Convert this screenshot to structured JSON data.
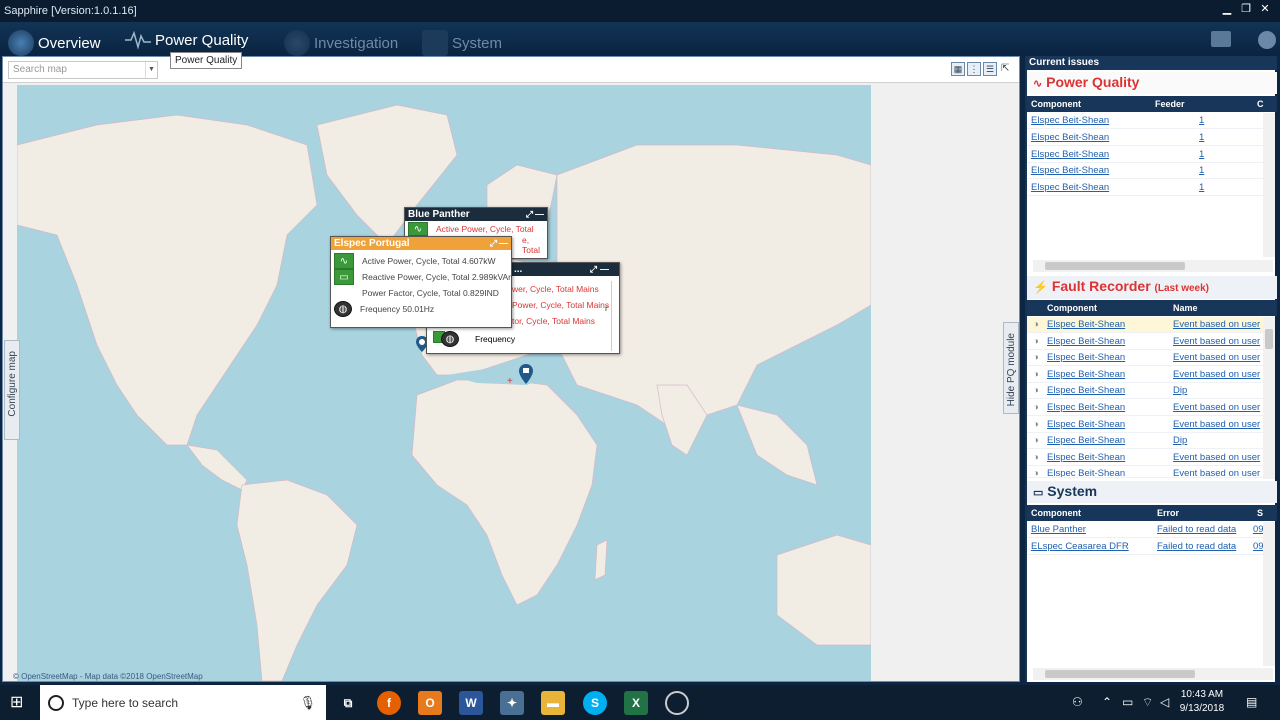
{
  "window": {
    "title": "Sapphire [Version:1.0.1.16]"
  },
  "nav": {
    "overview": "Overview",
    "power_quality": "Power Quality",
    "investigation": "Investigation",
    "system": "System",
    "tooltip": "Power Quality"
  },
  "map": {
    "search_placeholder": "Search map",
    "copyright": "© OpenStreetMap - Map data ©2018 OpenStreetMap",
    "configure_tab": "Configure map",
    "hide_tab": "Hide PQ module"
  },
  "popups": {
    "portugal": {
      "title": "Elspec Portugal",
      "rows": [
        "Active Power, Cycle, Total 4.607kW",
        "Reactive Power, Cycle, Total 2.989kVAr",
        "Power Factor, Cycle, Total 0.829IND",
        "Frequency 50.01Hz"
      ]
    },
    "blue_panther": {
      "title": "Blue Panther",
      "rows": [
        "Active Power, Cycle, Total",
        "e, Total"
      ]
    },
    "third": {
      "title": "...",
      "rows": [
        "wer, Cycle, Total Mains",
        "Power, Cycle, Total Mains",
        "tor, Cycle, Total Mains",
        "Frequency"
      ],
      "extra": "r"
    }
  },
  "current_issues": {
    "label": "Current issues",
    "power_quality": {
      "title": "Power Quality",
      "columns": [
        "Component",
        "Feeder",
        "C"
      ],
      "rows": [
        {
          "component": "Elspec Beit-Shean",
          "feeder": "1"
        },
        {
          "component": "Elspec Beit-Shean",
          "feeder": "1"
        },
        {
          "component": "Elspec Beit-Shean",
          "feeder": "1"
        },
        {
          "component": "Elspec Beit-Shean",
          "feeder": "1"
        },
        {
          "component": "Elspec Beit-Shean",
          "feeder": "1"
        }
      ]
    },
    "fault_recorder": {
      "title": "Fault Recorder",
      "subtitle": "(Last week)",
      "columns": [
        "Component",
        "Name"
      ],
      "rows": [
        {
          "component": "Elspec Beit-Shean",
          "name": "Event based on user"
        },
        {
          "component": "Elspec Beit-Shean",
          "name": "Event based on user"
        },
        {
          "component": "Elspec Beit-Shean",
          "name": "Event based on user"
        },
        {
          "component": "Elspec Beit-Shean",
          "name": "Event based on user"
        },
        {
          "component": "Elspec Beit-Shean",
          "name": "Dip"
        },
        {
          "component": "Elspec Beit-Shean",
          "name": "Event based on user"
        },
        {
          "component": "Elspec Beit-Shean",
          "name": "Event based on user"
        },
        {
          "component": "Elspec Beit-Shean",
          "name": "Dip"
        },
        {
          "component": "Elspec Beit-Shean",
          "name": "Event based on user"
        },
        {
          "component": "Elspec Beit-Shean",
          "name": "Event based on user"
        }
      ]
    },
    "system": {
      "title": "System",
      "columns": [
        "Component",
        "Error",
        "S"
      ],
      "rows": [
        {
          "component": "Blue Panther",
          "error": "Failed to read data",
          "s": "09"
        },
        {
          "component": "ELspec Ceasarea DFR",
          "error": "Failed to read data",
          "s": "09"
        }
      ]
    }
  },
  "taskbar": {
    "search_placeholder": "Type here to search",
    "time": "10:43 AM",
    "date": "9/13/2018"
  },
  "colors": {
    "accent_red": "#d33333",
    "nav_bg": "#0a2341",
    "popup_orange": "#f0a23a",
    "pq_green": "#3a9a3a"
  }
}
